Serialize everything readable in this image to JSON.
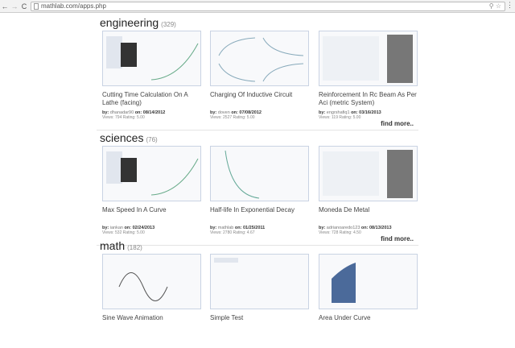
{
  "browser": {
    "url": "mathlab.com/apps.php"
  },
  "sections": [
    {
      "name": "engineering",
      "count": "(329)",
      "more": "find more..",
      "apps": [
        {
          "title": "Cutting Time Calculation On A Lathe (facing)",
          "by_label": "by:",
          "user": "dhanadar90",
          "on_label": "on:",
          "date": "08/14/2012",
          "stats": "Views: 794 Rating: 5.00"
        },
        {
          "title": "Charging Of Inductive Circuit",
          "by_label": "by:",
          "user": "doven",
          "on_label": "on:",
          "date": "07/08/2012",
          "stats": "Views: 2527 Rating: 5.00"
        },
        {
          "title": "Reinforcement In Rc Beam As Per Aci (metric System)",
          "by_label": "by:",
          "user": "engrshafiq1",
          "on_label": "on:",
          "date": "03/16/2013",
          "stats": "Views: 119 Rating: 5.00"
        }
      ]
    },
    {
      "name": "sciences",
      "count": "(76)",
      "more": "find more..",
      "apps": [
        {
          "title": "Max Speed In A Curve",
          "by_label": "by:",
          "user": "iankan",
          "on_label": "on:",
          "date": "02/24/2013",
          "stats": "Views: 532 Rating: 5.00"
        },
        {
          "title": "Half-life In Exponential Decay",
          "by_label": "by:",
          "user": "mathlab",
          "on_label": "on:",
          "date": "01/25/2011",
          "stats": "Views: 2780 Rating: 4.67"
        },
        {
          "title": "Moneda De Metal",
          "by_label": "by:",
          "user": "adrianoaredo123",
          "on_label": "on:",
          "date": "08/13/2013",
          "stats": "Views: 728 Rating: 4.50"
        }
      ]
    },
    {
      "name": "math",
      "count": "(182)",
      "apps": [
        {
          "title": "Sine Wave Animation"
        },
        {
          "title": "Simple Test"
        },
        {
          "title": "Area Under Curve"
        }
      ]
    }
  ]
}
